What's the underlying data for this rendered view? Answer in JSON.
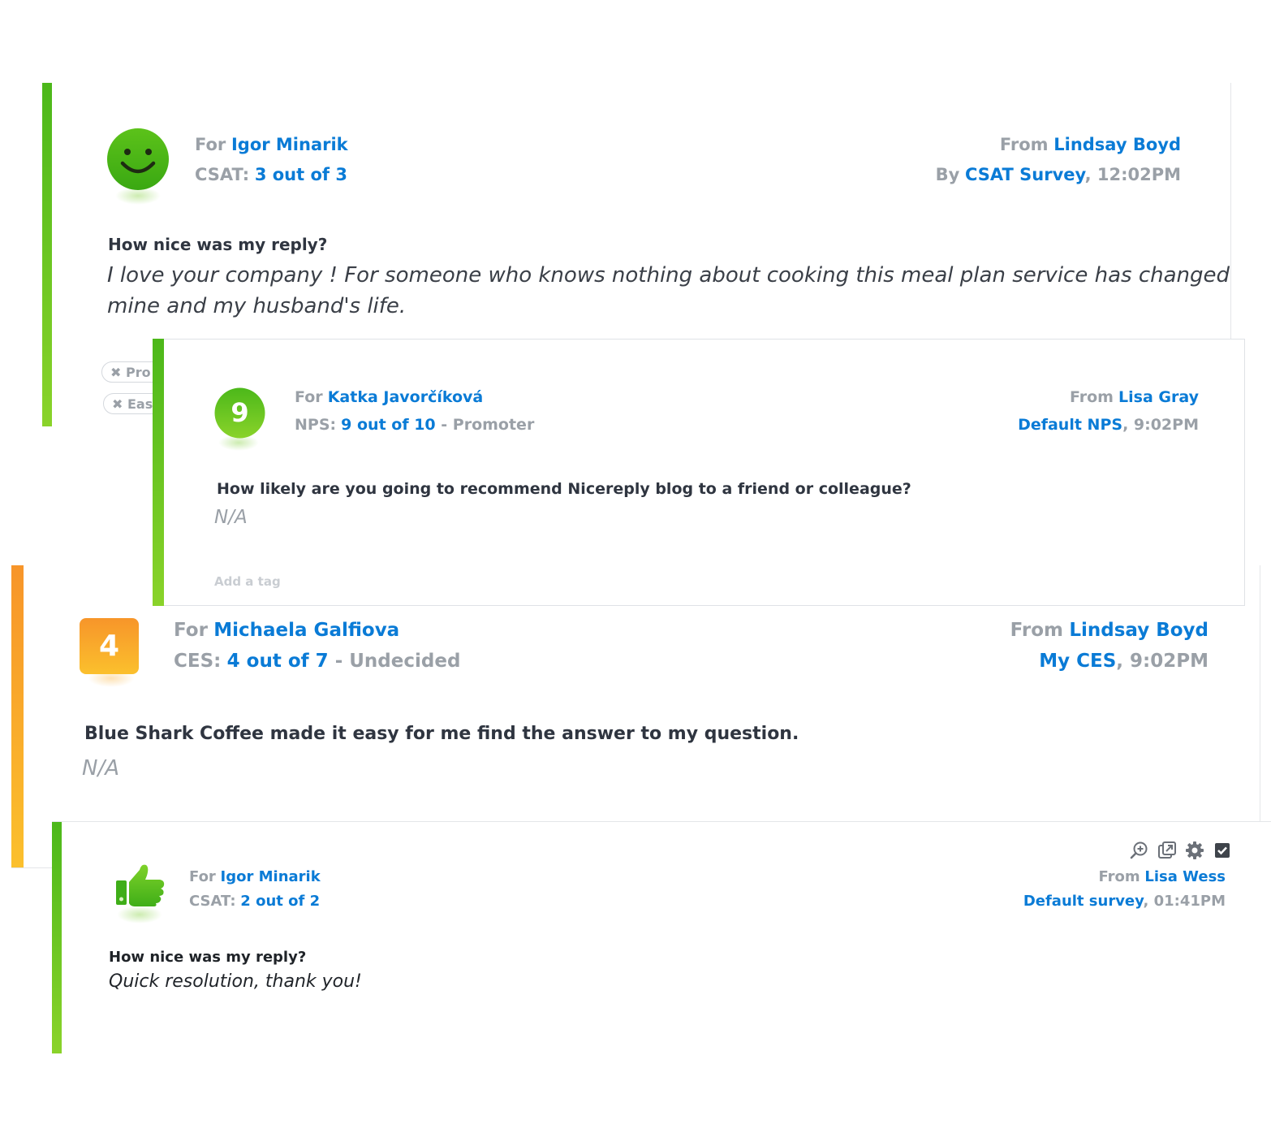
{
  "colors": {
    "green_top": "#4cb81a",
    "green_bottom": "#8ad32a",
    "orange_top": "#f7952a",
    "orange_bottom": "#fbc02d",
    "blue": "#0a7bd6",
    "grey": "#9aa0a7"
  },
  "card1": {
    "icon": "smiley-face-icon",
    "for_label": "For",
    "for_name": "Igor Minarik",
    "score_label": "CSAT:",
    "score_value": "3 out of 3",
    "from_label": "From",
    "from_name": "Lindsay Boyd",
    "by_label": "By",
    "survey_name": "CSAT Survey",
    "time": ", 12:02PM",
    "question": "How nice was my reply?",
    "answer_line1": "I love your company ! For someone who knows nothing about cooking this meal plan service has changed",
    "answer_line2": "mine and my husband's life.",
    "tags": [
      "Pro",
      "Eas"
    ]
  },
  "card2": {
    "score_badge": "9",
    "for_label": "For",
    "for_name": "Katka Javorčíková",
    "score_label": "NPS:",
    "score_value": "9 out of 10",
    "category": " - Promoter",
    "from_label": "From",
    "from_name": "Lisa Gray",
    "survey_name": "Default NPS",
    "time": ", 9:02PM",
    "question": "How likely are you going to recommend Nicereply blog to a friend or colleague?",
    "answer": "N/A",
    "add_tag": "Add a tag"
  },
  "card3": {
    "score_badge": "4",
    "for_label": "For",
    "for_name": "Michaela Galfiova",
    "score_label": "CES:",
    "score_value": "4 out of 7",
    "category": " - Undecided",
    "from_label": "From",
    "from_name": "Lindsay Boyd",
    "survey_name": "My CES",
    "time": ", 9:02PM",
    "question": "Blue Shark Coffee made it easy for me find the answer to my question.",
    "answer": "N/A"
  },
  "card4": {
    "icon": "thumbs-up-icon",
    "toolbar_icons": [
      "zoom-in-icon",
      "open-external-icon",
      "gear-icon",
      "checkbox-icon"
    ],
    "for_label": "For",
    "for_name": "Igor Minarik",
    "score_label": "CSAT:",
    "score_value": "2 out of 2",
    "from_label": "From",
    "from_name": "Lisa Wess",
    "survey_name": "Default survey",
    "time": ", 01:41PM",
    "question": "How nice was my reply?",
    "answer": "Quick resolution, thank you!"
  }
}
